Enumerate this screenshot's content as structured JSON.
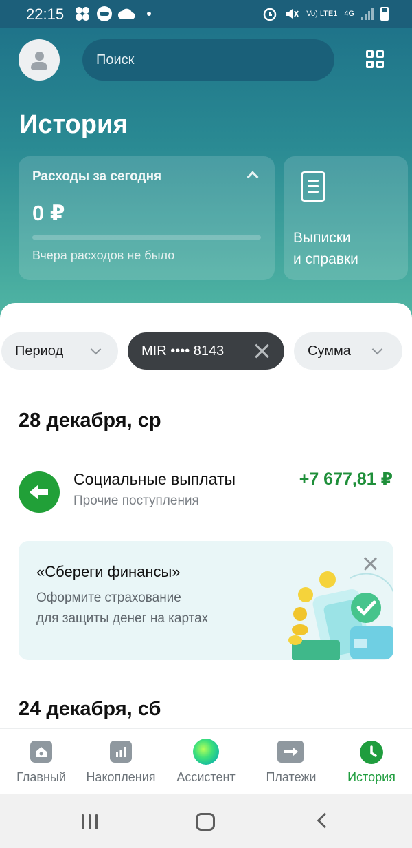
{
  "status_bar": {
    "time": "22:15",
    "network_label": "Vo) LTE1",
    "network_type": "4G"
  },
  "header": {
    "search_placeholder": "Поиск",
    "title": "История"
  },
  "expenses_card": {
    "title": "Расходы за сегодня",
    "amount": "0 ₽",
    "progress": 0,
    "subtitle": "Вчера расходов не было"
  },
  "statements_card": {
    "line1": "Выписки",
    "line2": "и справки"
  },
  "filters": {
    "period": "Период",
    "card": "MIR •••• 8143",
    "sum": "Сумма"
  },
  "groups": [
    {
      "date": "28 декабря, ср",
      "transactions": [
        {
          "name": "Социальные выплаты",
          "category": "Прочие поступления",
          "amount": "+7 677,81 ₽",
          "amount_color": "#1f8f3a"
        }
      ]
    },
    {
      "date": "24 декабря, сб"
    }
  ],
  "promo": {
    "title": "«Сбереги финансы»",
    "line1": "Оформите страхование",
    "line2": "для защиты денег на картах"
  },
  "tabs": [
    {
      "label": "Главный",
      "icon": "home-icon"
    },
    {
      "label": "Накопления",
      "icon": "chart-icon"
    },
    {
      "label": "Ассистент",
      "icon": "assistant-orb-icon"
    },
    {
      "label": "Платежи",
      "icon": "arrow-right-icon"
    },
    {
      "label": "История",
      "icon": "clock-icon",
      "active": true
    }
  ],
  "colors": {
    "accent_green": "#1f9d3e",
    "header_teal": "#1c6e87"
  }
}
